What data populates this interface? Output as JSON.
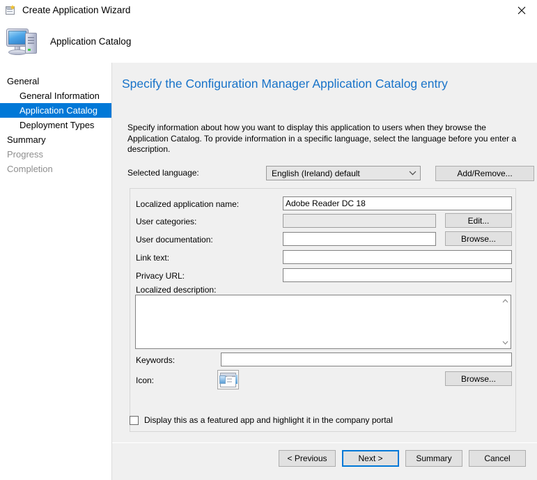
{
  "window": {
    "title": "Create Application Wizard",
    "icon": "wizard-window-icon",
    "close_label": "✕"
  },
  "header": {
    "title": "Application Catalog",
    "icon": "computer-icon"
  },
  "nav": {
    "items": [
      {
        "label": "General",
        "level": 0,
        "state": "normal"
      },
      {
        "label": "General Information",
        "level": 1,
        "state": "normal"
      },
      {
        "label": "Application Catalog",
        "level": 1,
        "state": "selected"
      },
      {
        "label": "Deployment Types",
        "level": 1,
        "state": "normal"
      },
      {
        "label": "Summary",
        "level": 0,
        "state": "normal"
      },
      {
        "label": "Progress",
        "level": 0,
        "state": "disabled"
      },
      {
        "label": "Completion",
        "level": 0,
        "state": "disabled"
      }
    ]
  },
  "page": {
    "title": "Specify the Configuration Manager Application Catalog entry",
    "description": "Specify information about how you want to display this application to users when they browse the Application Catalog. To provide information in a specific language, select the language before you enter a description."
  },
  "language": {
    "label": "Selected language:",
    "selected": "English (Ireland) default",
    "options": [
      "English (Ireland) default"
    ],
    "add_remove_label": "Add/Remove..."
  },
  "fields": {
    "app_name": {
      "label": "Localized application name:",
      "value": "Adobe Reader DC 18",
      "placeholder": ""
    },
    "user_categories": {
      "label": "User categories:",
      "value": "",
      "placeholder": "",
      "button": "Edit..."
    },
    "user_documentation": {
      "label": "User documentation:",
      "value": "",
      "placeholder": "",
      "button": "Browse..."
    },
    "link_text": {
      "label": "Link text:",
      "value": "",
      "placeholder": ""
    },
    "privacy_url": {
      "label": "Privacy URL:",
      "value": "",
      "placeholder": ""
    },
    "description": {
      "label": "Localized description:",
      "value": "",
      "placeholder": ""
    },
    "keywords": {
      "label": "Keywords:",
      "value": "",
      "placeholder": ""
    },
    "icon": {
      "label": "Icon:",
      "button": "Browse...",
      "preview": "application-window-icon"
    }
  },
  "featured_app": {
    "label": "Display this as a featured app and highlight it in the company portal",
    "checked": false
  },
  "footer": {
    "previous": "< Previous",
    "next": "Next >",
    "summary": "Summary",
    "cancel": "Cancel"
  },
  "colors": {
    "accent": "#0078d7",
    "title_blue": "#1873c9",
    "panel": "#f0f0f0",
    "button_face": "#e1e1e1"
  }
}
